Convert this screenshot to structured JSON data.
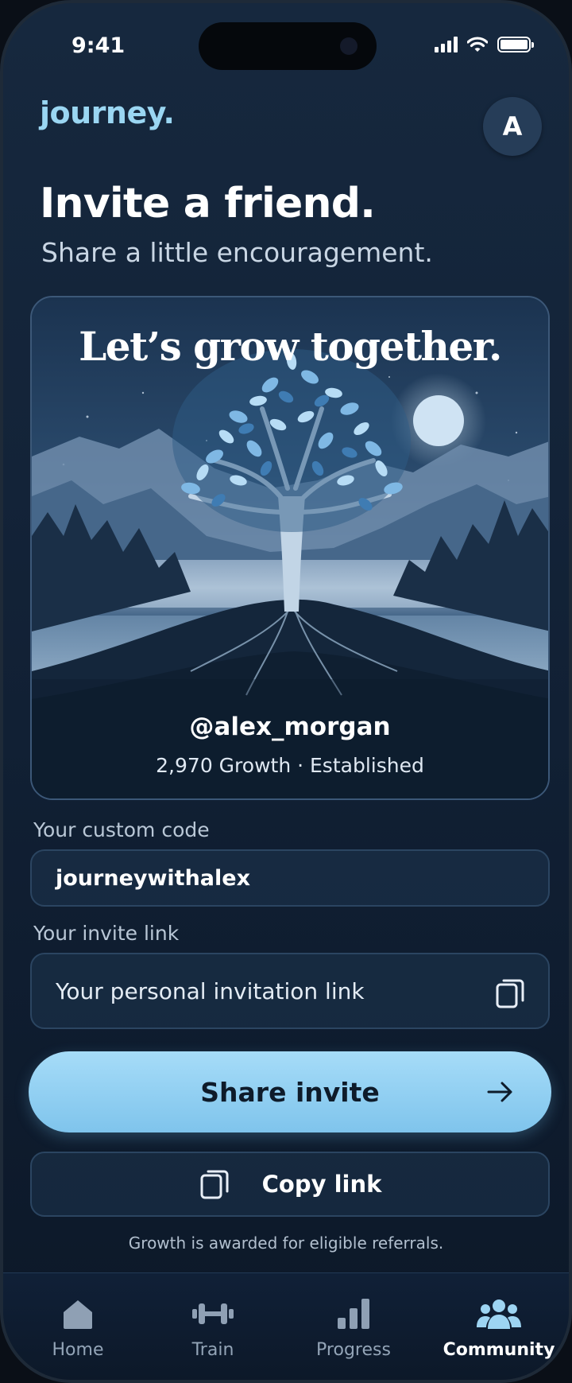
{
  "status_bar": {
    "time": "9:41"
  },
  "header": {
    "logo": "journey.",
    "avatar_initial": "A"
  },
  "page": {
    "title": "Invite a friend.",
    "subtitle": "Share a little encouragement."
  },
  "card": {
    "headline": "Let’s grow together.",
    "handle": "@alex_morgan",
    "stats": "2,970 Growth · Established"
  },
  "custom_code": {
    "label": "Your custom code",
    "value": "journeywithalex"
  },
  "invite_link": {
    "label": "Your invite link",
    "placeholder": "Your personal invitation link",
    "icon": "copy-icon"
  },
  "actions": {
    "share_label": "Share invite",
    "copy_label": "Copy link"
  },
  "footnote": "Growth is awarded for eligible referrals.",
  "tabs": [
    {
      "label": "Home",
      "icon": "home-icon",
      "active": false
    },
    {
      "label": "Train",
      "icon": "dumbbell-icon",
      "active": false
    },
    {
      "label": "Progress",
      "icon": "bar-chart-icon",
      "active": false
    },
    {
      "label": "Community",
      "icon": "people-icon",
      "active": true
    }
  ],
  "colors": {
    "accent": "#8fd0f2",
    "background": "#132338",
    "tab_active": "#ffffff"
  }
}
